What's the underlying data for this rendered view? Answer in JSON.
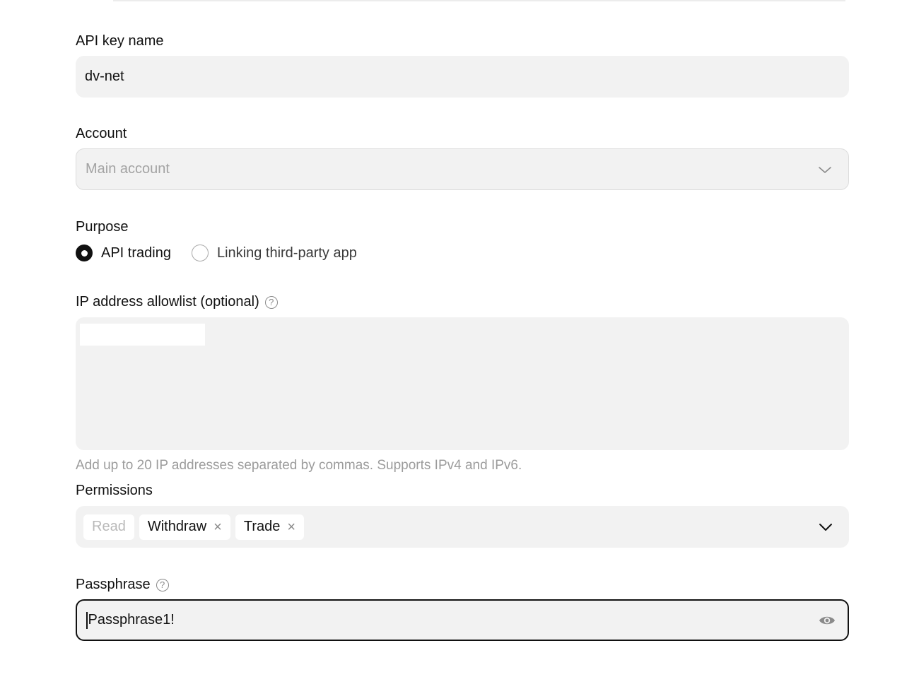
{
  "api_key_name": {
    "label": "API key name",
    "value": "dv-net"
  },
  "account": {
    "label": "Account",
    "placeholder": "Main account",
    "icon": "chevron-down-icon"
  },
  "purpose": {
    "label": "Purpose",
    "options": [
      {
        "label": "API trading",
        "checked": true
      },
      {
        "label": "Linking third-party app",
        "checked": false
      }
    ]
  },
  "ip_allowlist": {
    "label": "IP address allowlist (optional)",
    "help": "?",
    "hint": "Add up to 20 IP addresses separated by commas. Supports IPv4 and IPv6."
  },
  "permissions": {
    "label": "Permissions",
    "tags": [
      {
        "label": "Read",
        "removable": false
      },
      {
        "label": "Withdraw",
        "removable": true,
        "remove": "×"
      },
      {
        "label": "Trade",
        "removable": true,
        "remove": "×"
      }
    ]
  },
  "passphrase": {
    "label": "Passphrase",
    "help": "?",
    "value": "Passphrase1!",
    "icon": "eye-icon"
  }
}
